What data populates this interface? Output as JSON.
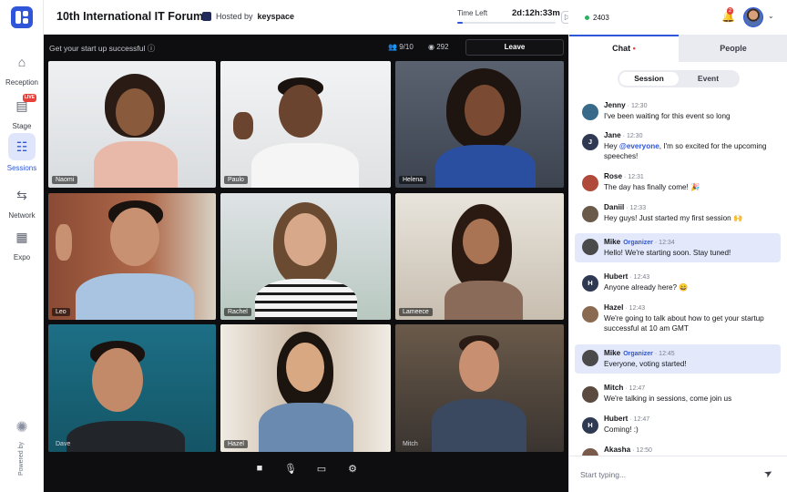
{
  "header": {
    "event_title": "10th International IT Forum",
    "hosted_by": "Hosted by",
    "host_name": "keyspace",
    "time_left_label": "Time Left",
    "time_left_value": "2d:12h:33m",
    "time_progress": 0.06,
    "online_count": "2403",
    "notification_count": "2"
  },
  "sidebar": {
    "items": [
      {
        "label": "Reception",
        "icon": "home-icon"
      },
      {
        "label": "Stage",
        "icon": "stage-icon",
        "badge": "LIVE"
      },
      {
        "label": "Sessions",
        "icon": "sessions-icon"
      },
      {
        "label": "Network",
        "icon": "handshake-icon"
      },
      {
        "label": "Expo",
        "icon": "store-icon"
      }
    ],
    "powered_by": "Powered by"
  },
  "stage": {
    "title": "Get your start up successful",
    "participants": "9/10",
    "viewers": "292",
    "leave_label": "Leave",
    "tiles": [
      {
        "name": "Naomi"
      },
      {
        "name": "Paulo"
      },
      {
        "name": "Helena"
      },
      {
        "name": "Leo"
      },
      {
        "name": "Rachel"
      },
      {
        "name": "Lameece"
      },
      {
        "name": "Dave"
      },
      {
        "name": "Hazel"
      },
      {
        "name": "Mitch"
      }
    ],
    "controls": [
      "camera-icon",
      "microphone-icon",
      "screen-share-icon",
      "settings-gear-icon"
    ]
  },
  "chat": {
    "tab_chat": "Chat",
    "tab_people": "People",
    "seg_session": "Session",
    "seg_event": "Event",
    "organizer_label": "Organizer",
    "placeholder": "Start typing...",
    "messages": [
      {
        "name": "Jenny",
        "time": "12:30",
        "text": "I've been waiting for this event so long"
      },
      {
        "name": "Jane",
        "time": "12:30",
        "pre": "Hey ",
        "mention": "@everyone",
        "text": ", I'm so excited for the upcoming speeches!"
      },
      {
        "name": "Rose",
        "time": "12:31",
        "text": "The day has finally come! 🎉"
      },
      {
        "name": "Daniil",
        "time": "12:33",
        "text": "Hey guys! Just started my first session 🙌"
      },
      {
        "name": "Mike",
        "time": "12:34",
        "text": "Hello! We're starting soon. Stay tuned!"
      },
      {
        "name": "Hubert",
        "time": "12:43",
        "text": "Anyone already here? 😄"
      },
      {
        "name": "Hazel",
        "time": "12:43",
        "text": "We're going to talk about how to get your startup successful at 10 am GMT"
      },
      {
        "name": "Mike",
        "time": "12:45",
        "text": "Everyone, voting started!"
      },
      {
        "name": "Mitch",
        "time": "12:47",
        "text": "We're talking in sessions, come join us"
      },
      {
        "name": "Hubert",
        "time": "12:47",
        "text": "Coming! :)"
      },
      {
        "name": "Akasha",
        "time": "12:50",
        "text": ""
      }
    ]
  }
}
